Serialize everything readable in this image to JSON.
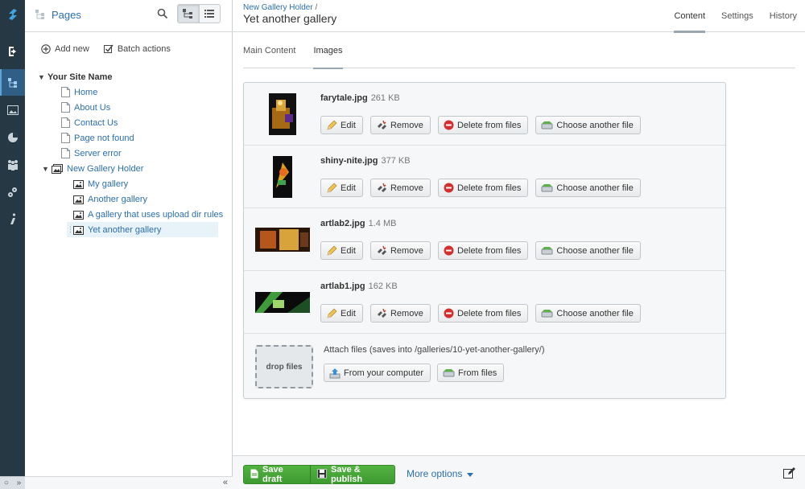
{
  "tree": {
    "title": "Pages",
    "add_new": "Add new",
    "batch_actions": "Batch actions",
    "nodes": [
      {
        "label": "Your Site Name"
      },
      {
        "label": "Home"
      },
      {
        "label": "About Us"
      },
      {
        "label": "Contact Us"
      },
      {
        "label": "Page not found"
      },
      {
        "label": "Server error"
      },
      {
        "label": "New Gallery Holder"
      },
      {
        "label": "My gallery"
      },
      {
        "label": "Another gallery"
      },
      {
        "label": "A gallery that uses upload dir rules"
      },
      {
        "label": "Yet another gallery"
      }
    ]
  },
  "header": {
    "breadcrumb": "New Gallery Holder",
    "breadcrumb_sep": "/",
    "title": "Yet another gallery",
    "tabs": [
      {
        "label": "Content"
      },
      {
        "label": "Settings"
      },
      {
        "label": "History"
      }
    ]
  },
  "subtabs": [
    {
      "label": "Main Content"
    },
    {
      "label": "Images"
    }
  ],
  "buttons": {
    "edit": "Edit",
    "remove": "Remove",
    "delete": "Delete from files",
    "choose": "Choose another file"
  },
  "files": [
    {
      "name": "farytale.jpg",
      "size": "261 KB"
    },
    {
      "name": "shiny-nite.jpg",
      "size": "377 KB"
    },
    {
      "name": "artlab2.jpg",
      "size": "1.4 MB"
    },
    {
      "name": "artlab1.jpg",
      "size": "162 KB"
    }
  ],
  "attach": {
    "drop": "drop files",
    "text": "Attach files (saves into /galleries/10-yet-another-gallery/)",
    "from_computer": "From your computer",
    "from_files": "From files"
  },
  "actions": {
    "save_draft": "Save draft",
    "save_publish": "Save & publish",
    "more_options": "More options"
  },
  "colors": {
    "rail": "#273845",
    "link": "#2b6fad",
    "save_green": "#4aa83a"
  }
}
